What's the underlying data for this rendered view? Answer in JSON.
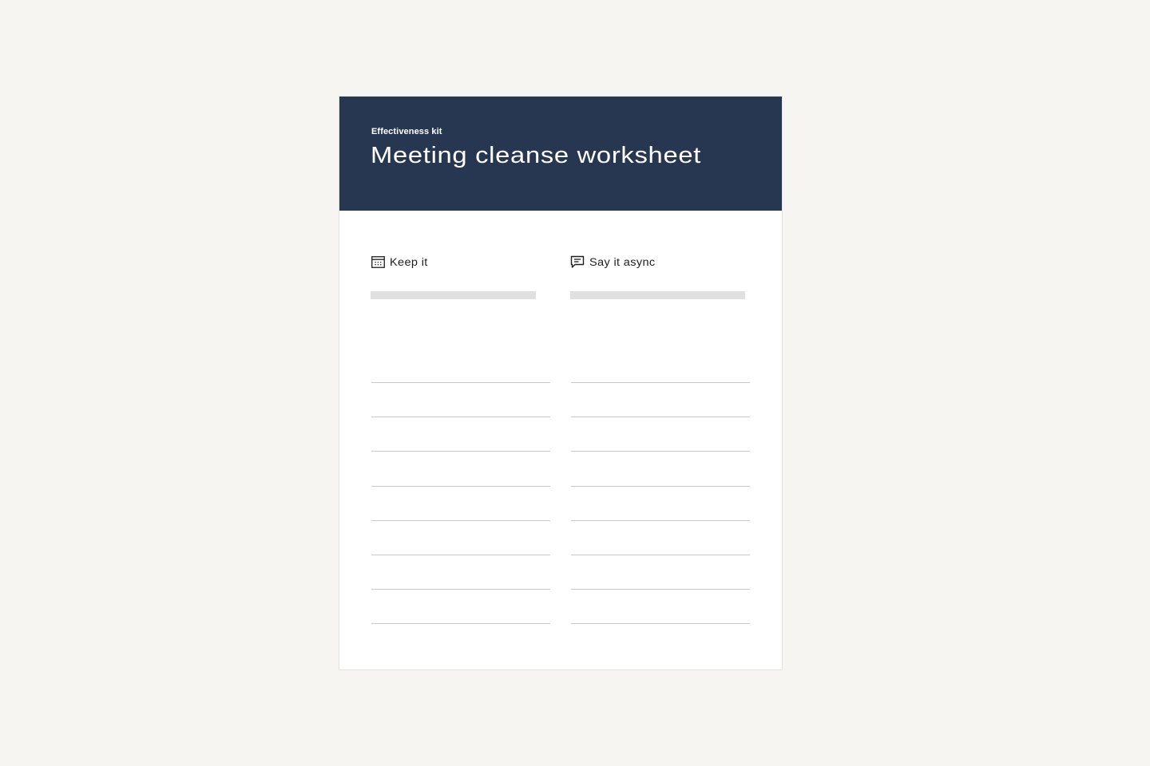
{
  "header": {
    "eyebrow": "Effectiveness kit",
    "title": "Meeting cleanse worksheet",
    "background_color": "#283751"
  },
  "columns": [
    {
      "label": "Keep it",
      "icon": "calendar-icon",
      "entry_lines": 8
    },
    {
      "label": "Say it async",
      "icon": "chat-bubble-icon",
      "entry_lines": 8
    }
  ]
}
